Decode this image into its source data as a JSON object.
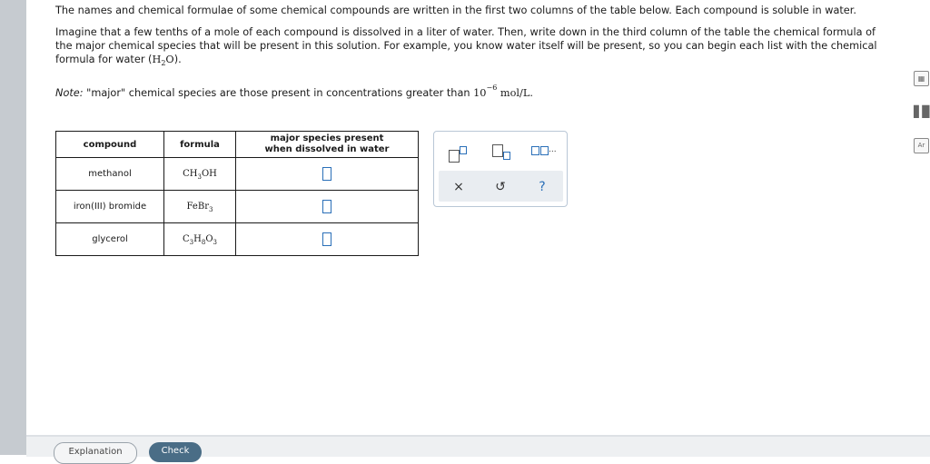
{
  "question": {
    "intro": "The names and chemical formulae of some chemical compounds are written in the first two columns of the table below. Each compound is soluble in water.",
    "para2_a": "Imagine that a few tenths of a mole of each compound is dissolved in a liter of water. Then, write down in the third column of the table the chemical formula of the major chemical species that will be present in this solution. For example, you know water itself will be present, so you can begin each list with the chemical formula for water (",
    "para2_h": "H",
    "para2_2": "2",
    "para2_o": "O",
    "para2_end": ").",
    "note_label": "Note:",
    "note_text": " \"major\" chemical species are those present in concentrations greater than ",
    "note_base": "10",
    "note_exp": "−6",
    "note_unit": "mol/L."
  },
  "table": {
    "headers": [
      "compound",
      "formula",
      "major species present",
      "when dissolved in water"
    ],
    "rows": [
      {
        "compound": "methanol",
        "f1": "CH",
        "f1s": "3",
        "f2": "OH",
        "f2s": "",
        "f3": "",
        "f3s": ""
      },
      {
        "compound": "iron(III) bromide",
        "f1": "FeBr",
        "f1s": "3",
        "f2": "",
        "f2s": "",
        "f3": "",
        "f3s": ""
      },
      {
        "compound": "glycerol",
        "f1": "C",
        "f1s": "3",
        "f2": "H",
        "f2s": "8",
        "f3": "O",
        "f3s": "3"
      }
    ]
  },
  "palette": {
    "dots": "...",
    "clear": "×",
    "undo": "↺",
    "help": "?"
  },
  "right_icons": [
    "calculator-icon",
    "bar-chart-icon",
    "periodic-table-icon"
  ],
  "buttons": {
    "explanation": "Explanation",
    "check": "Check"
  }
}
